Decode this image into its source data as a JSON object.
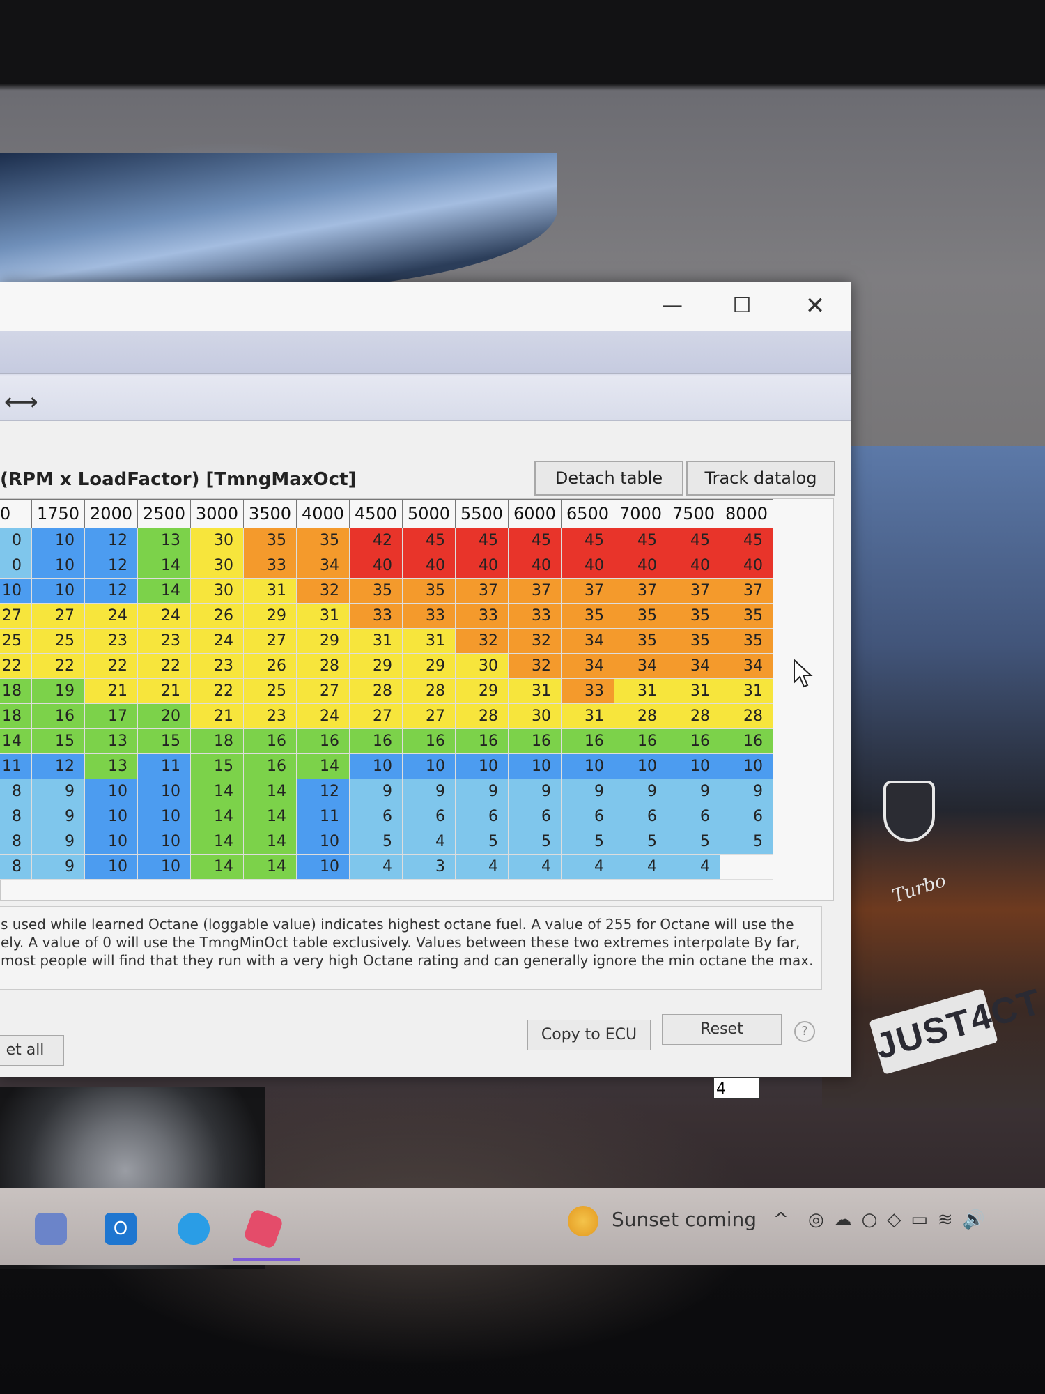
{
  "window": {
    "title_prefix": "(RPM x LoadFactor) [TmngMaxOct]",
    "detach_label": "Detach table",
    "track_label": "Track datalog"
  },
  "table": {
    "columns": [
      "0",
      "1750",
      "2000",
      "2500",
      "3000",
      "3500",
      "4000",
      "4500",
      "5000",
      "5500",
      "6000",
      "6500",
      "7000",
      "7500",
      "8000"
    ],
    "rows": [
      [
        "0",
        "10",
        "12",
        "13",
        "30",
        "35",
        "35",
        "42",
        "45",
        "45",
        "45",
        "45",
        "45",
        "45",
        "45"
      ],
      [
        "0",
        "10",
        "12",
        "14",
        "30",
        "33",
        "34",
        "40",
        "40",
        "40",
        "40",
        "40",
        "40",
        "40",
        "40"
      ],
      [
        "10",
        "10",
        "12",
        "14",
        "30",
        "31",
        "32",
        "35",
        "35",
        "37",
        "37",
        "37",
        "37",
        "37",
        "37"
      ],
      [
        "27",
        "27",
        "24",
        "24",
        "26",
        "29",
        "31",
        "33",
        "33",
        "33",
        "33",
        "35",
        "35",
        "35",
        "35"
      ],
      [
        "25",
        "25",
        "23",
        "23",
        "24",
        "27",
        "29",
        "31",
        "31",
        "32",
        "32",
        "34",
        "35",
        "35",
        "35"
      ],
      [
        "22",
        "22",
        "22",
        "22",
        "23",
        "26",
        "28",
        "29",
        "29",
        "30",
        "32",
        "34",
        "34",
        "34",
        "34"
      ],
      [
        "18",
        "19",
        "21",
        "21",
        "22",
        "25",
        "27",
        "28",
        "28",
        "29",
        "31",
        "33",
        "31",
        "31",
        "31"
      ],
      [
        "18",
        "16",
        "17",
        "20",
        "21",
        "23",
        "24",
        "27",
        "27",
        "28",
        "30",
        "31",
        "28",
        "28",
        "28"
      ],
      [
        "14",
        "15",
        "13",
        "15",
        "18",
        "16",
        "16",
        "16",
        "16",
        "16",
        "16",
        "16",
        "16",
        "16",
        "16"
      ],
      [
        "11",
        "12",
        "13",
        "11",
        "15",
        "16",
        "14",
        "10",
        "10",
        "10",
        "10",
        "10",
        "10",
        "10",
        "10"
      ],
      [
        "8",
        "9",
        "10",
        "10",
        "14",
        "14",
        "12",
        "9",
        "9",
        "9",
        "9",
        "9",
        "9",
        "9",
        "9"
      ],
      [
        "8",
        "9",
        "10",
        "10",
        "14",
        "14",
        "11",
        "6",
        "6",
        "6",
        "6",
        "6",
        "6",
        "6",
        "6"
      ],
      [
        "8",
        "9",
        "10",
        "10",
        "14",
        "14",
        "10",
        "5",
        "4",
        "5",
        "5",
        "5",
        "5",
        "5",
        "5"
      ],
      [
        "8",
        "9",
        "10",
        "10",
        "14",
        "14",
        "10",
        "4",
        "3",
        "4",
        "4",
        "4",
        "4",
        "4",
        ""
      ]
    ],
    "edit_value": "4"
  },
  "description": "s used while learned Octane (loggable value) indicates highest octane fuel.  A value of 255 for Octane will use the ely.  A value of 0 will use the TmngMinOct table exclusively.  Values between these two extremes interpolate By far, most people will find that they run with a very high Octane rating and can generally ignore the min octane the max.",
  "buttons": {
    "set_all": "et all",
    "copy_to_ecu": "Copy to ECU",
    "reset": "Reset",
    "help": "?"
  },
  "taskbar": {
    "weather_text": "Sunset coming",
    "outlook_letter": "O"
  },
  "wallpaper": {
    "plate_text": "JUST4CT",
    "badge_text": "Turbo"
  },
  "colors": {
    "red": "#e8342a",
    "orange": "#f49a2c",
    "yellow": "#f7e53c",
    "green": "#7cd24a",
    "teal": "#46c8a8",
    "blue": "#4c9cf0",
    "light_blue": "#7fc6ec"
  }
}
